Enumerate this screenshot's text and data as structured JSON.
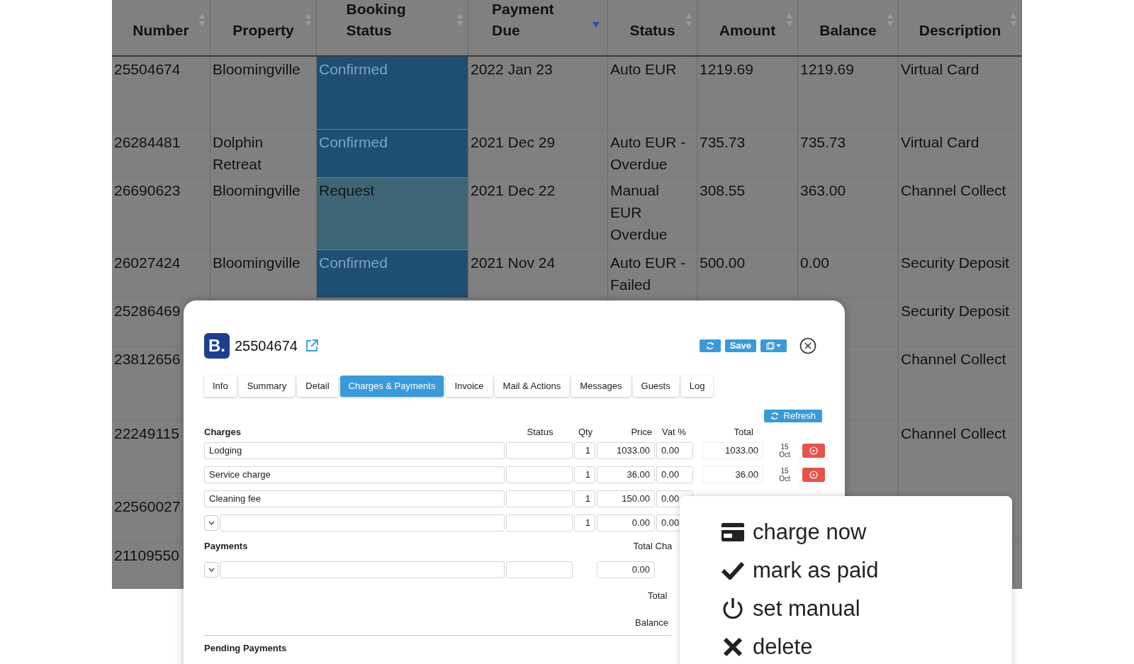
{
  "table": {
    "columns": [
      {
        "label": "Number",
        "sorted": false
      },
      {
        "label": "Property",
        "sorted": false
      },
      {
        "label": "Booking Status",
        "sorted": false
      },
      {
        "label": "Payment Due",
        "sorted": true
      },
      {
        "label": "Status",
        "sorted": false
      },
      {
        "label": "Amount",
        "sorted": false
      },
      {
        "label": "Balance",
        "sorted": false
      },
      {
        "label": "Description",
        "sorted": false
      }
    ],
    "rows": [
      {
        "number": "25504674",
        "property": "Bloomingville",
        "booking_status": {
          "text": "Confirmed",
          "kind": "confirmed"
        },
        "payment_due": "2022 Jan 23",
        "status": "Auto EUR",
        "amount": "1219.69",
        "balance": "1219.69",
        "description": "Virtual Card"
      },
      {
        "number": "26284481",
        "property": "Dolphin Retreat",
        "booking_status": {
          "text": "Confirmed",
          "kind": "confirmed"
        },
        "payment_due": "2021 Dec 29",
        "status": "Auto EUR - Overdue",
        "amount": "735.73",
        "balance": "735.73",
        "description": "Virtual Card"
      },
      {
        "number": "26690623",
        "property": "Bloomingville",
        "booking_status": {
          "text": "Request",
          "kind": "request"
        },
        "payment_due": "2021 Dec 22",
        "status": "Manual EUR Overdue",
        "amount": "308.55",
        "balance": "363.00",
        "description": "Channel Collect"
      },
      {
        "number": "26027424",
        "property": "Bloomingville",
        "booking_status": {
          "text": "Confirmed",
          "kind": "confirmed"
        },
        "payment_due": "2021 Nov 24",
        "status": "Auto EUR - Failed",
        "amount": "500.00",
        "balance": "0.00",
        "description": "Security Deposit"
      },
      {
        "number": "25286469",
        "description": "Security Deposit"
      },
      {
        "number": "23812656",
        "description": "Channel Collect"
      },
      {
        "number": "22249115",
        "description": "Channel Collect"
      },
      {
        "number": "22560027"
      },
      {
        "number": "21109550"
      }
    ]
  },
  "dialog": {
    "logo": "B.",
    "booking_number": "25504674",
    "save": "Save",
    "tabs": [
      {
        "label": "Info",
        "selected": false
      },
      {
        "label": "Summary",
        "selected": false
      },
      {
        "label": "Detail",
        "selected": false
      },
      {
        "label": "Charges & Payments",
        "selected": true
      },
      {
        "label": "Invoice",
        "selected": false
      },
      {
        "label": "Mail & Actions",
        "selected": false
      },
      {
        "label": "Messages",
        "selected": false
      },
      {
        "label": "Guests",
        "selected": false
      },
      {
        "label": "Log",
        "selected": false
      }
    ],
    "refresh": "Refresh",
    "charges_header": {
      "title": "Charges",
      "status": "Status",
      "qty": "Qty",
      "price": "Price",
      "vat": "Vat %",
      "total": "Total"
    },
    "charges": [
      {
        "kind": "item",
        "description": "Lodging",
        "qty": "1",
        "price": "1033.00",
        "vat": "0.00",
        "total": "1033.00",
        "date": {
          "day": "15",
          "month": "Oct"
        }
      },
      {
        "kind": "item",
        "description": "Service charge",
        "qty": "1",
        "price": "36.00",
        "vat": "0.00",
        "total": "36.00",
        "date": {
          "day": "15",
          "month": "Oct"
        }
      },
      {
        "kind": "item",
        "description": "Cleaning fee",
        "qty": "1",
        "price": "150.00",
        "vat": "0.00"
      },
      {
        "kind": "new",
        "qty": "1",
        "price": "0.00",
        "vat": "0.00"
      }
    ],
    "payments_title": "Payments",
    "total_charges_label": "Total Cha",
    "payments": [
      {
        "kind": "new",
        "amount": "0.00"
      }
    ],
    "total_label": "Total",
    "balance_label": "Balance",
    "pending_title": "Pending Payments"
  },
  "menu": [
    {
      "kind": "card",
      "label": "charge now"
    },
    {
      "kind": "check",
      "label": "mark as paid"
    },
    {
      "kind": "power",
      "label": "set manual"
    },
    {
      "kind": "cross",
      "label": "delete"
    }
  ]
}
